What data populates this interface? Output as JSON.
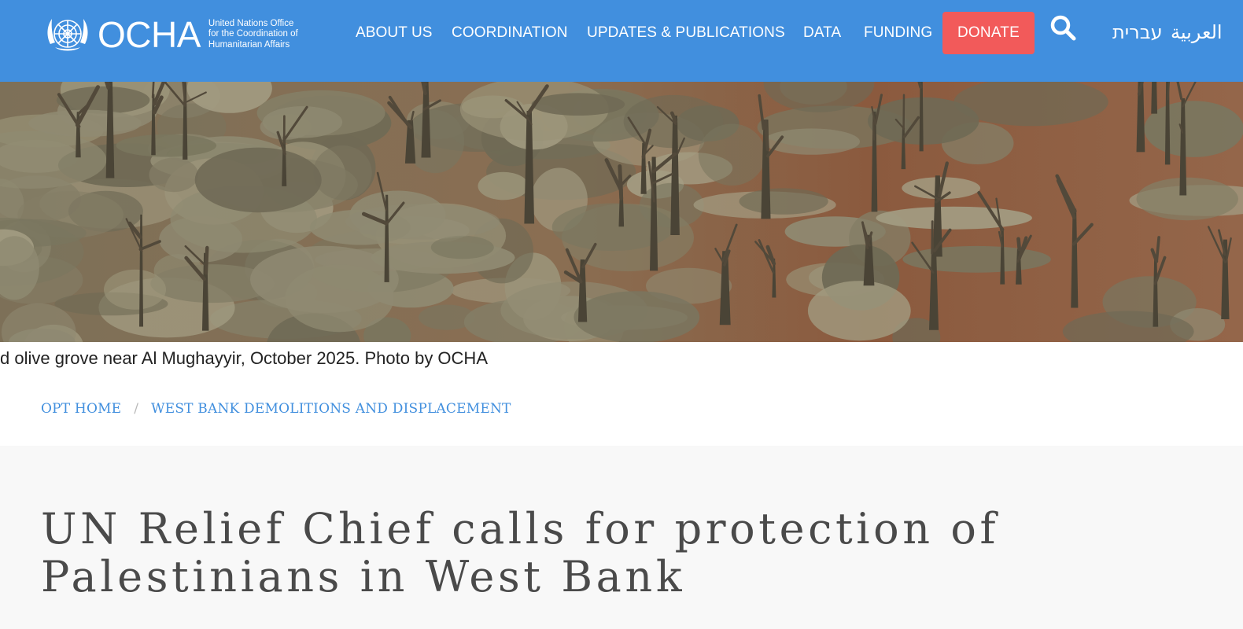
{
  "header": {
    "logo": {
      "wordmark": "OCHA",
      "subtitle_lines": [
        "United Nations Office",
        "for the Coordination of",
        "Humanitarian Affairs"
      ],
      "emblem_icon": "un-emblem-icon"
    },
    "nav": [
      {
        "label": "ABOUT US"
      },
      {
        "label": "COORDINATION"
      },
      {
        "label": "UPDATES & PUBLICATIONS"
      },
      {
        "label": "DATA"
      },
      {
        "label": "FUNDING"
      }
    ],
    "donate_label": "DONATE",
    "search_icon": "search-icon",
    "languages": {
      "hebrew": "עברית",
      "arabic": "العربية"
    },
    "background_color": "#418fde",
    "donate_color": "#f25a5a"
  },
  "hero": {
    "image_subject": "olive grove with cut olive trees",
    "caption": "d olive grove near Al Mughayyir, October 2025. Photo by OCHA"
  },
  "breadcrumb": [
    {
      "label": "OPT HOME"
    },
    {
      "label": "WEST BANK DEMOLITIONS AND DISPLACEMENT"
    }
  ],
  "page": {
    "title": "UN Relief Chief calls for protection of Palestinians in West Bank"
  }
}
